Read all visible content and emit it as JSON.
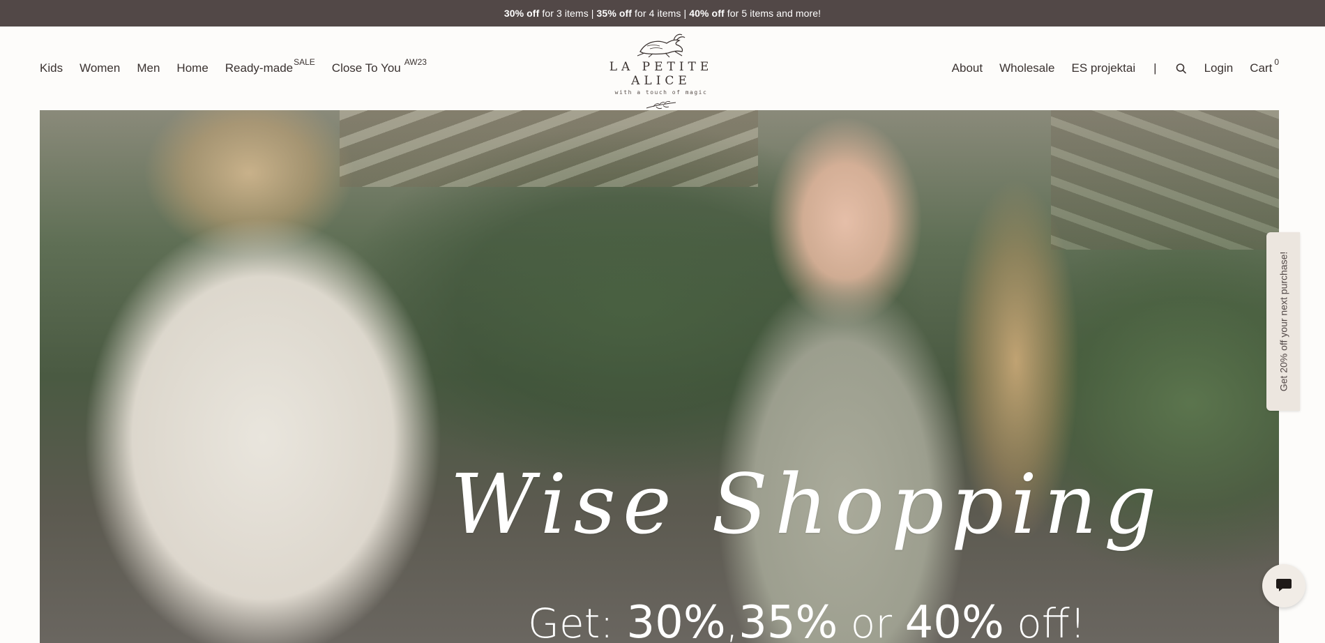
{
  "promo": {
    "p1_bold": "30% off",
    "p1_rest": "for 3 items",
    "separator": "|",
    "p2_bold": "35% off",
    "p2_rest": "for 4 items",
    "p3_bold": "40% off",
    "p3_rest": "for 5 items and more!"
  },
  "nav_left": {
    "kids": "Kids",
    "women": "Women",
    "men": "Men",
    "home": "Home",
    "ready_made": "Ready-made",
    "ready_made_badge": "SALE",
    "close_to_you": "Close To You",
    "close_to_you_badge": "AW23"
  },
  "logo": {
    "title": "LA PETITE ALICE",
    "tagline": "with a touch of magic"
  },
  "nav_right": {
    "about": "About",
    "wholesale": "Wholesale",
    "es_projects": "ES projektai",
    "divider": "|",
    "login": "Login",
    "cart": "Cart",
    "cart_count": "0"
  },
  "hero": {
    "script_title": "Wise Shopping",
    "offer_prefix": "Get:",
    "offer_30": "30%",
    "offer_comma": ",",
    "offer_35": "35%",
    "offer_or": "or",
    "offer_40": "40%",
    "offer_suffix": "off!"
  },
  "side_tab": {
    "label": "Get 20% off your next purchase!"
  },
  "icons": {
    "search": "search-icon",
    "chat": "chat-bubble-icon",
    "hare": "hare-icon",
    "sprig": "sprig-icon"
  },
  "colors": {
    "promo_bg": "#524847",
    "page_bg": "#fdfcfa",
    "text": "#3a3230",
    "side_tab_bg": "#ece6df"
  }
}
